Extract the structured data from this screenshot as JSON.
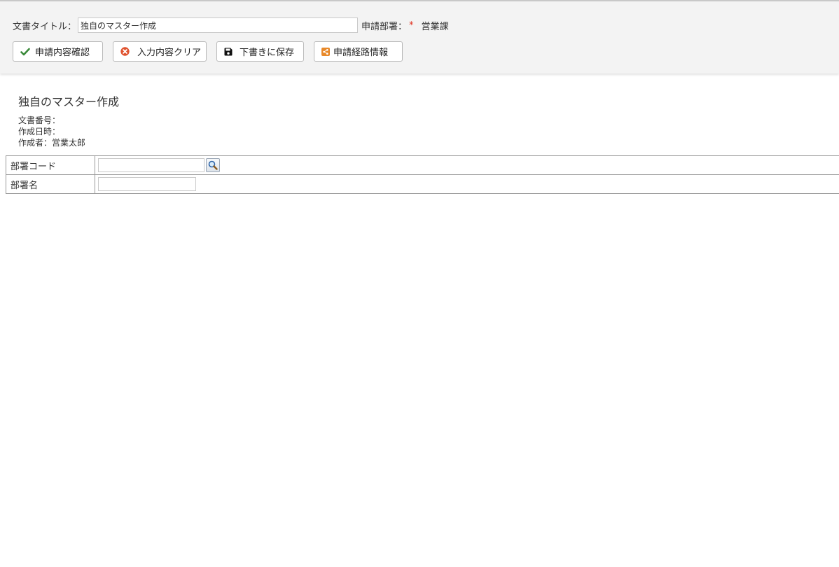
{
  "toolbar": {
    "title_label": "文書タイトル：",
    "title_value": "独自のマスター作成",
    "dept_label": "申請部署：",
    "required_mark": "*",
    "dept_value": "営業課",
    "buttons": [
      {
        "label": "申請内容確認",
        "icon": "check-icon",
        "color": "#3a8a3a"
      },
      {
        "label": "入力内容クリア",
        "icon": "clear-circle-icon",
        "color": "#e0532f"
      },
      {
        "label": "下書きに保存",
        "icon": "save-icon",
        "color": "#111111"
      },
      {
        "label": "申請経路情報",
        "icon": "share-icon",
        "color": "#e8892a"
      }
    ]
  },
  "document": {
    "heading": "独自のマスター作成",
    "number_label": "文書番号：",
    "created_label": "作成日時：",
    "author_label": "作成者：",
    "author_value": "営業太郎"
  },
  "form": {
    "rows": [
      {
        "label": "部署コード",
        "value": "",
        "has_search": true
      },
      {
        "label": "部署名",
        "value": "",
        "has_search": false
      }
    ]
  },
  "colors": {
    "toolbar_bg": "#f3f3f3",
    "required": "#e0301e"
  }
}
